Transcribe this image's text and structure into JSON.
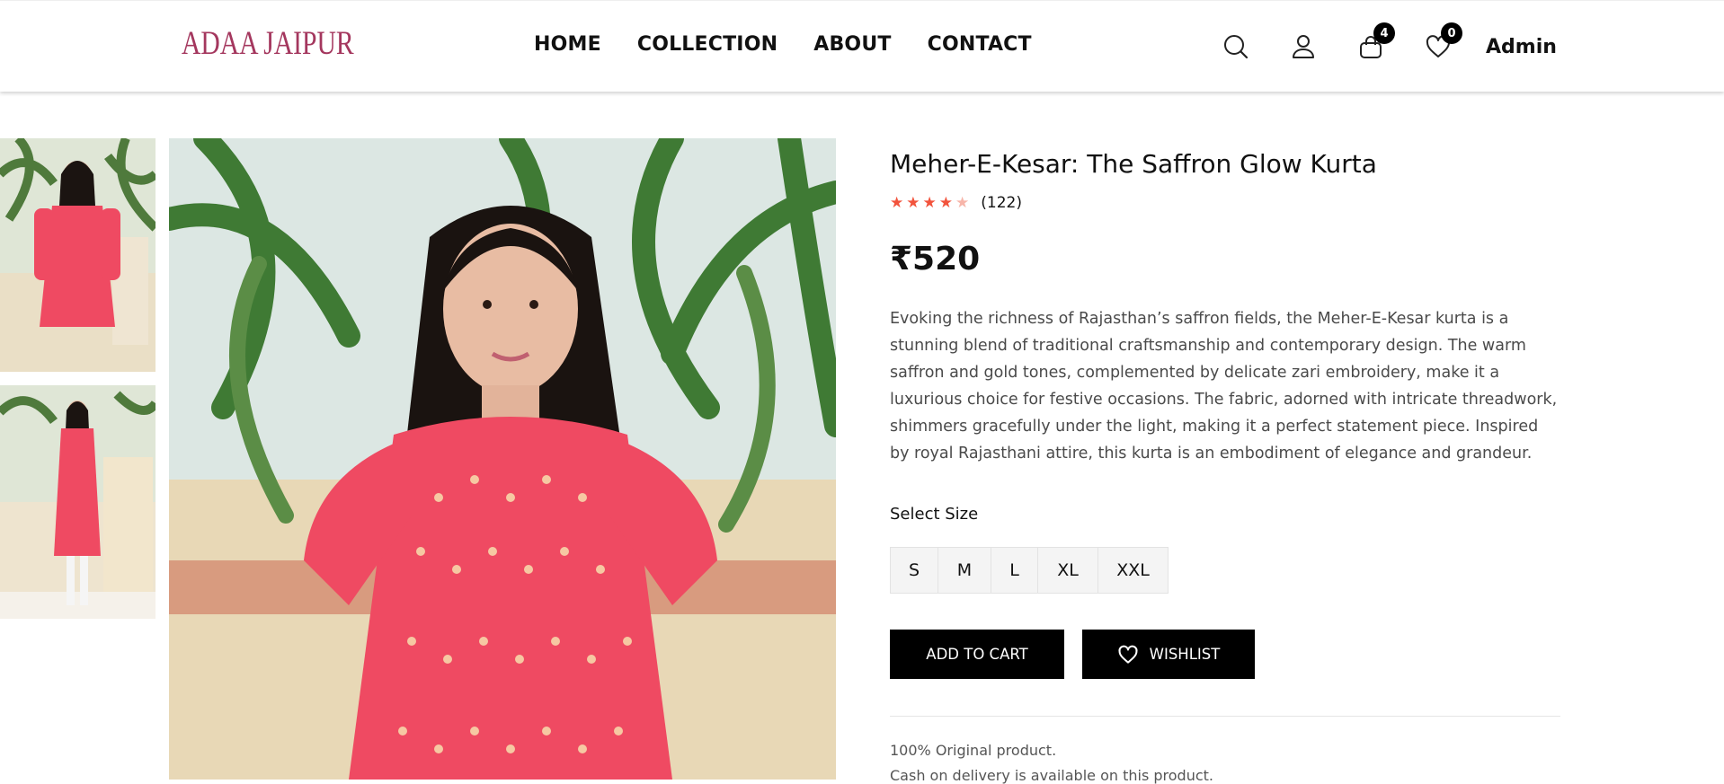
{
  "brand": {
    "logo": "ADAA JAIPUR"
  },
  "nav": {
    "items": [
      "HOME",
      "COLLECTION",
      "ABOUT",
      "CONTACT"
    ]
  },
  "header_icons": {
    "search": "search-icon",
    "account": "user-icon",
    "cart": "cart-icon",
    "wishlist": "heart-icon",
    "cart_count": "4",
    "wishlist_count": "0",
    "user_label": "Admin"
  },
  "product": {
    "title": "Meher-E-Kesar: The Saffron Glow Kurta",
    "rating": 4,
    "rating_max": 5,
    "review_count": "(122)",
    "price": "₹520",
    "description": "Evoking the richness of Rajasthan’s saffron fields, the Meher-E-Kesar kurta is a stunning blend of traditional craftsmanship and contemporary design. The warm saffron and gold tones, complemented by delicate zari embroidery, make it a luxurious choice for festive occasions. The fabric, adorned with intricate threadwork, shimmers gracefully under the light, making it a perfect statement piece. Inspired by royal Rajasthani attire, this kurta is an embodiment of elegance and grandeur.",
    "size_label": "Select Size",
    "sizes": [
      "S",
      "M",
      "L",
      "XL",
      "XXL"
    ],
    "add_to_cart": "ADD TO CART",
    "wishlist": "WISHLIST",
    "notes": [
      "100% Original product.",
      "Cash on delivery is available on this product."
    ]
  },
  "colors": {
    "star_filled": "#f2533c",
    "star_empty": "#f7b5a9",
    "logo": "#a4375e",
    "button": "#000000",
    "kurta": "#ef4a62"
  }
}
